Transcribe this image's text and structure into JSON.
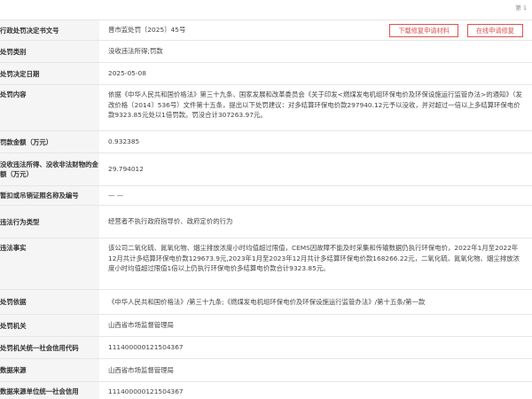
{
  "page_mark": "第 1",
  "header": {
    "download_button": "下载修复申请材料",
    "online_button": "在线申请修复"
  },
  "rows": [
    {
      "label": "行政处罚决定书文号",
      "value": "晋市监处罚〔2025〕45号"
    },
    {
      "label": "处罚类别",
      "value": "没收违法所得;罚款"
    },
    {
      "label": "处罚决定日期",
      "value": "2025-05-08"
    },
    {
      "label": "处罚内容",
      "value": "依据《中华人民共和国价格法》第三十九条、国家发展和改革委员会《关于印发<燃煤发电机组环保电价及环保设施运行监管办法>的通知》（发改价格〔2014〕536号）文件第十五条，提出以下处罚建议：对多结算环保电价款297940.12元予以没收，并对超过一倍以上多结算环保电价款9323.85元处以1倍罚款。罚没合计307263.97元。"
    },
    {
      "label": "罚款金额（万元）",
      "value": "0.932385"
    },
    {
      "label": "没收违法所得、没收非法财物的金额（万元）",
      "value": "29.794012"
    },
    {
      "label": "暂扣或吊销证照名称及编号",
      "value": "— —"
    },
    {
      "label": "违法行为类型",
      "value": "经营者不执行政府指导价、政府定价的行为"
    },
    {
      "label": "违法事实",
      "value": "该公司二氧化硫、氮氧化物、烟尘排放浓度小时均值超过限值，CEMS因故障不能及时采集和传输数据仍执行环保电价，2022年1月至2022年12月共计多结算环保电价款129673.9元,2023年1月至2023年12月共计多结算环保电价款168266.22元，二氧化硫、氮氧化物、烟尘排放浓度小时均值超过限值1倍以上仍执行环保电价多结算电价款合计9323.85元。"
    },
    {
      "label": "处罚依据",
      "value": "《中华人民共和国价格法》/第三十九条;《燃煤发电机组环保电价及环保设施运行监管办法》/第十五条/第一款"
    },
    {
      "label": "处罚机关",
      "value": "山西省市场监督管理局"
    },
    {
      "label": "处罚机关统一社会信用代码",
      "value": "11140000012150436​7"
    },
    {
      "label": "数据来源",
      "value": "山西省市场监督管理局"
    },
    {
      "label": "数据来源单位统一社会信用",
      "value": "11140000012150436​7"
    }
  ]
}
